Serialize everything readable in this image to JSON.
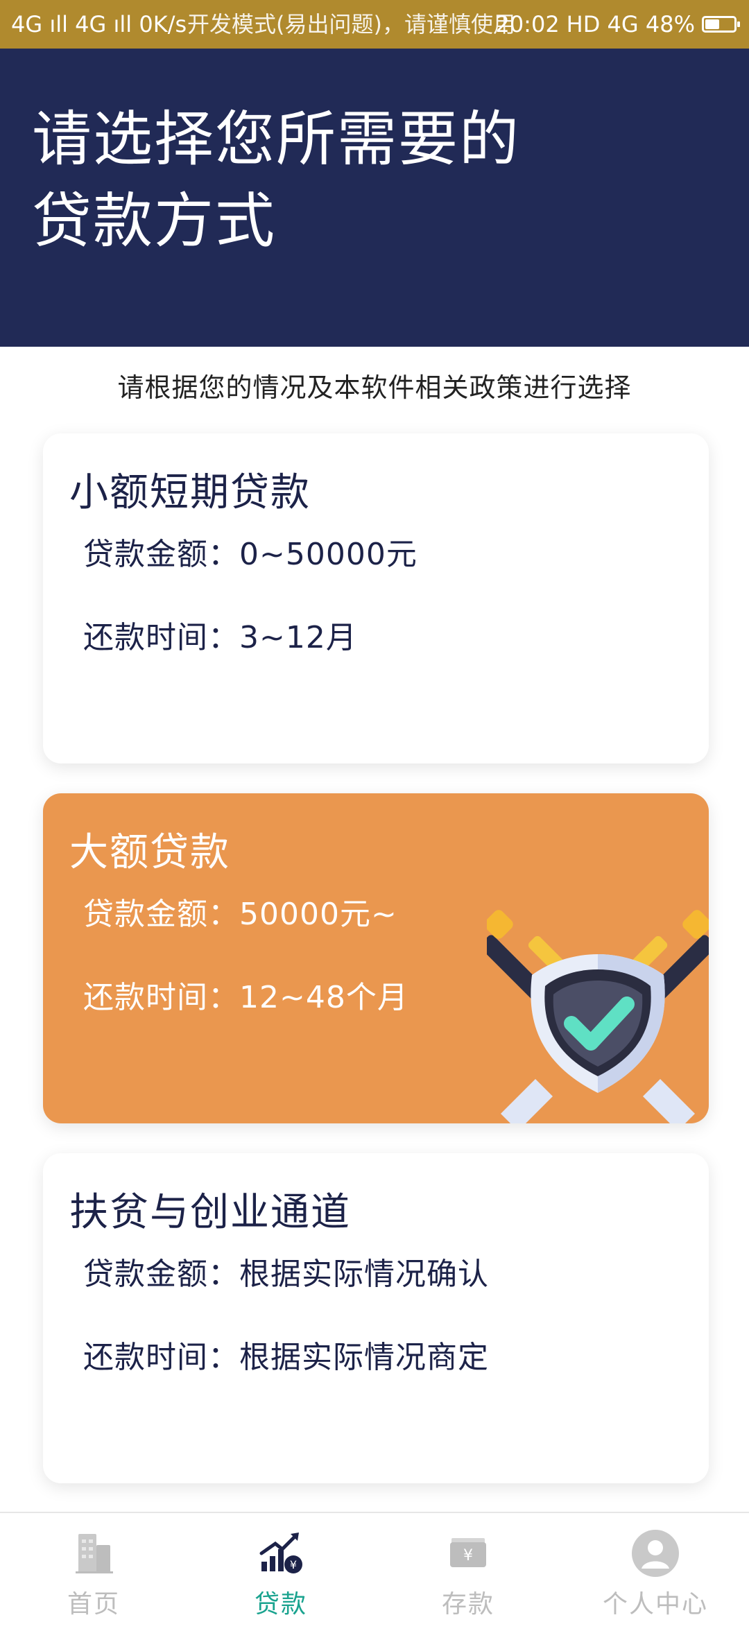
{
  "status_bar": {
    "left": "4G ıll 4G ıll 0K/s",
    "center": "开发模式(易出问题)，请谨慎使用",
    "time": "20:02",
    "right": "HD 4G 48%",
    "battery_percent": 48
  },
  "header": {
    "title_line1": "请选择您所需要的",
    "title_line2": "贷款方式"
  },
  "subtitle": "请根据您的情况及本软件相关政策进行选择",
  "cards": [
    {
      "title": "小额短期贷款",
      "amount": "贷款金额：0~50000元",
      "term": "还款时间：3~12月"
    },
    {
      "title": "大额贷款",
      "amount": "贷款金额：50000元~",
      "term": "还款时间：12~48个月",
      "accent_color": "#ea974f"
    },
    {
      "title": "扶贫与创业通道",
      "amount": "贷款金额：根据实际情况确认",
      "term": "还款时间：根据实际情况商定"
    }
  ],
  "bottom_nav": {
    "items": [
      {
        "label": "首页",
        "icon": "building-icon",
        "active": false
      },
      {
        "label": "贷款",
        "icon": "chart-up-icon",
        "active": true
      },
      {
        "label": "存款",
        "icon": "wallet-icon",
        "active": false
      },
      {
        "label": "个人中心",
        "icon": "user-avatar-icon",
        "active": false
      }
    ],
    "active_color": "#1aa38f"
  },
  "colors": {
    "header_bg": "#212a56",
    "status_bar_bg": "#b08a2e",
    "card_highlight": "#ea974f"
  }
}
